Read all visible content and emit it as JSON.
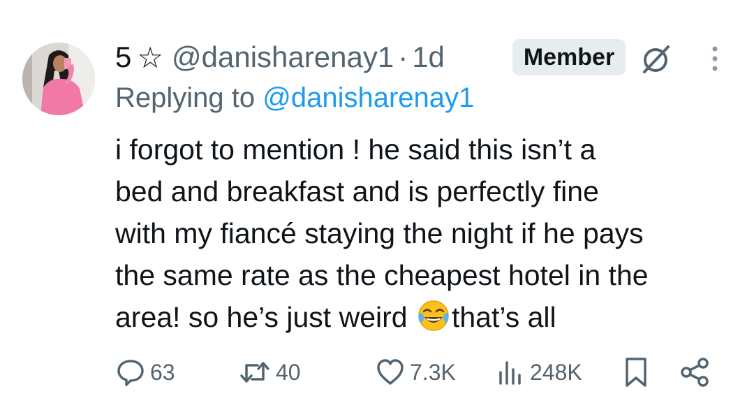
{
  "author": {
    "rank": "5",
    "star": "☆",
    "handle": "@danisharenay1",
    "separator": "·",
    "time": "1d",
    "badge": "Member"
  },
  "reply": {
    "prefix": "Replying to",
    "handle": "@danisharenay1"
  },
  "tweet": {
    "lines": [
      "i forgot to mention ! he said this isn’t a",
      "bed and breakfast and is perfectly fine",
      "with my fiancé staying the night if he pays",
      "the same rate as the cheapest hotel in the"
    ],
    "last_line_before_emoji": "area! so he’s just weird ",
    "emoji": "face-with-tears-of-joy",
    "last_line_after_emoji": "that’s all"
  },
  "actions": {
    "replies": "63",
    "reposts": "40",
    "likes": "7.3K",
    "views": "248K"
  },
  "icons": {
    "grok": "grok-icon",
    "more": "more-vertical-icon",
    "reply": "reply-icon",
    "repost": "repost-icon",
    "like": "heart-icon",
    "views": "views-icon",
    "bookmark": "bookmark-icon",
    "share": "share-icon"
  },
  "colors": {
    "text": "#0f1419",
    "secondary": "#536471",
    "link": "#1d9bf0",
    "badge_bg": "#e7ecef"
  }
}
